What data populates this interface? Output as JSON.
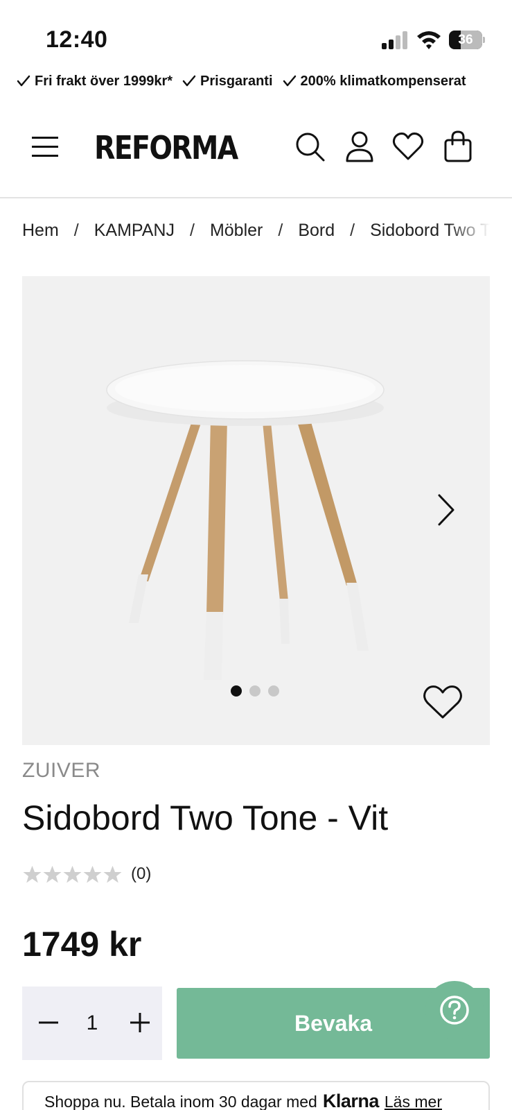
{
  "status_bar": {
    "time": "12:40",
    "battery_level": "36",
    "battery_fraction": 0.36,
    "signal_icon": "cellular-signal-icon",
    "wifi_icon": "wifi-icon"
  },
  "usp": [
    {
      "text": "Fri frakt över 1999kr*",
      "icon": "check-icon"
    },
    {
      "text": "Prisgaranti",
      "icon": "check-icon"
    },
    {
      "text": "200% klimatkompenserat",
      "icon": "check-icon"
    }
  ],
  "header": {
    "logo": "REFORMA",
    "icons": [
      "menu-icon",
      "search-icon",
      "account-icon",
      "wishlist-icon",
      "cart-icon"
    ]
  },
  "breadcrumb": {
    "items": [
      "Hem",
      "KAMPANJ",
      "Möbler",
      "Bord",
      "Sidobord Two Tone - Vit"
    ],
    "separator": "/"
  },
  "gallery": {
    "image_count": 3,
    "active_index": 0,
    "next_icon": "chevron-right-icon",
    "wishlist_icon": "heart-outline-icon"
  },
  "product": {
    "brand": "ZUIVER",
    "title": "Sidobord Two Tone - Vit",
    "rating_stars": 0,
    "rating_max": 5,
    "rating_count": "(0)",
    "price": "1749 kr"
  },
  "purchase": {
    "quantity": "1",
    "cta_label": "Bevaka",
    "help_icon": "question-mark-icon"
  },
  "klarna": {
    "text": "Shoppa nu. Betala inom 30 dagar med",
    "logo": "Klarna",
    "link": "Läs mer"
  },
  "colors": {
    "accent": "#74b997",
    "gallery_bg": "#f1f1f1",
    "qty_bg": "#efeff5",
    "brand_text": "#8a8a8a"
  }
}
